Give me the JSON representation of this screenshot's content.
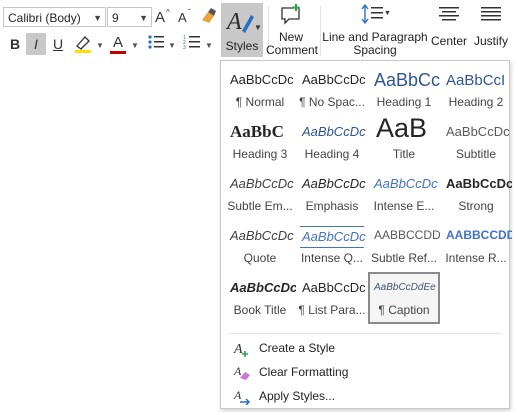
{
  "ribbon": {
    "font_name": "Calibri (Body)",
    "font_size": "9",
    "bold": "B",
    "italic": "I",
    "underline": "U",
    "font_color_letter": "A",
    "styles_label": "Styles",
    "new_comment_line1": "New",
    "new_comment_line2": "Comment",
    "line_spacing_line1": "Line and Paragraph",
    "line_spacing_line2": "Spacing",
    "center_label": "Center",
    "justify_label": "Justify",
    "accent_red": "#c00000",
    "highlight_yellow": "#ffe000"
  },
  "gallery": {
    "styles": [
      {
        "sample": "AaBbCcDc",
        "name": "¶ Normal"
      },
      {
        "sample": "AaBbCcDc",
        "name": "¶ No Spac..."
      },
      {
        "sample": "AaBbCc",
        "name": "Heading 1"
      },
      {
        "sample": "AaBbCcI",
        "name": "Heading 2"
      },
      {
        "sample": "AaBbC",
        "name": "Heading 3"
      },
      {
        "sample": "AaBbCcDc",
        "name": "Heading 4"
      },
      {
        "sample": "AaB",
        "name": "Title"
      },
      {
        "sample": "AaBbCcDc",
        "name": "Subtitle"
      },
      {
        "sample": "AaBbCcDc",
        "name": "Subtle Em..."
      },
      {
        "sample": "AaBbCcDc",
        "name": "Emphasis"
      },
      {
        "sample": "AaBbCcDc",
        "name": "Intense E..."
      },
      {
        "sample": "AaBbCcDc",
        "name": "Strong"
      },
      {
        "sample": "AaBbCcDc",
        "name": "Quote"
      },
      {
        "sample": "AaBbCcDc",
        "name": "Intense Q..."
      },
      {
        "sample": "AABBCCDD",
        "name": "Subtle Ref..."
      },
      {
        "sample": "AABBCCDD",
        "name": "Intense R..."
      },
      {
        "sample": "AaBbCcDc",
        "name": "Book Title"
      },
      {
        "sample": "AaBbCcDc",
        "name": "¶ List Para..."
      },
      {
        "sample": "AaBbCcDdEe",
        "name": "¶ Caption"
      }
    ],
    "menu": {
      "create_style": "Create a Style",
      "clear_formatting": "Clear Formatting",
      "apply_styles": "Apply Styles..."
    },
    "heading_blue": "#2f5496",
    "selected_style": "¶ Caption"
  }
}
